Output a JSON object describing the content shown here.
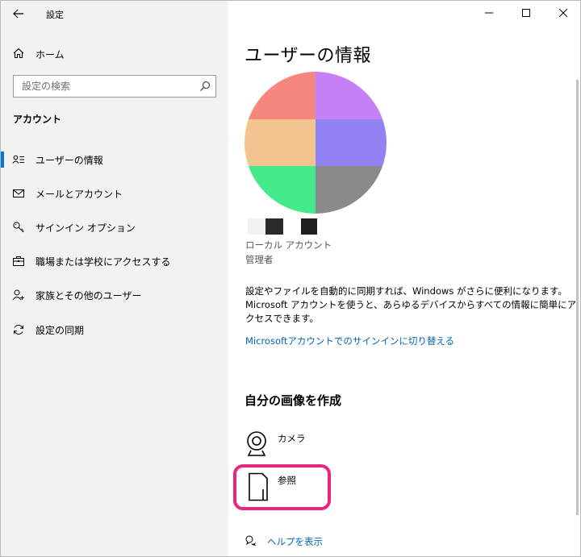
{
  "window": {
    "title": "設定"
  },
  "sidebar": {
    "home_label": "ホーム",
    "search_placeholder": "設定の検索",
    "section_heading": "アカウント",
    "items": [
      {
        "label": "ユーザーの情報",
        "icon": "user-info-icon",
        "active": true
      },
      {
        "label": "メールとアカウント",
        "icon": "mail-icon",
        "active": false
      },
      {
        "label": "サインイン オプション",
        "icon": "key-icon",
        "active": false
      },
      {
        "label": "職場または学校にアクセスする",
        "icon": "briefcase-icon",
        "active": false
      },
      {
        "label": "家族とその他のユーザー",
        "icon": "add-person-icon",
        "active": false
      },
      {
        "label": "設定の同期",
        "icon": "sync-icon",
        "active": false
      }
    ]
  },
  "main": {
    "page_title": "ユーザーの情報",
    "account_type": "ローカル アカウント",
    "account_role": "管理者",
    "description_lines": [
      "設定やファイルを自動的に同期すれば、Windows がさらに便利になります。",
      "Microsoft アカウントを使うと、あらゆるデバイスからすべての情報に簡単にア",
      "クセスできます。"
    ],
    "ms_link": "Microsoftアカウントでのサインインに切り替える",
    "create_heading": "自分の画像を作成",
    "camera_label": "カメラ",
    "browse_label": "参照",
    "help_link": "ヘルプを表示"
  },
  "colors": {
    "accent": "#0078d7",
    "link": "#0063b1",
    "highlight": "#e8267f",
    "sidebar_bg": "#f2f2f2",
    "avatar_cells": [
      "#f7877c",
      "#c580f5",
      "#f2c48e",
      "#9183f2",
      "#42ea8a",
      "#8a8a8a"
    ]
  }
}
